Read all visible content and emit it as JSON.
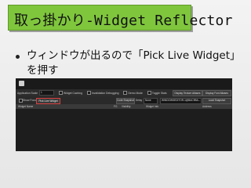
{
  "slide": {
    "title": "取っ掛かり-Widget Reflector",
    "bullet": "ウィンドウが出るので「Pick Live Widget」を押す"
  },
  "editor": {
    "toolbar": {
      "app_scale_label": "Application Scale",
      "app_scale_value": "1",
      "widget_caching": "Widget Caching",
      "invalidation_debugging": "Invalidation Debugging",
      "demo_mode": "Demo Mode",
      "toggle_stats": "Toggle Stats",
      "display_texture_atlases": "Display Texture Atlases",
      "display_font_atlases": "Display Font Atlases"
    },
    "filter": {
      "show_focus": "Show Focus",
      "pick_live_widget": "Pick Live Widget",
      "code_snapshot": "Code Snapshot",
      "delay_label": "Delay",
      "delay_value": "None",
      "target_window": "WINDOWSEDITOR-1@BAC9BA...",
      "load_snapshot": "Load Snapshot"
    },
    "columns": [
      "Widget Name",
      "FG",
      "Visibility",
      "Widget Info",
      "Address"
    ]
  }
}
